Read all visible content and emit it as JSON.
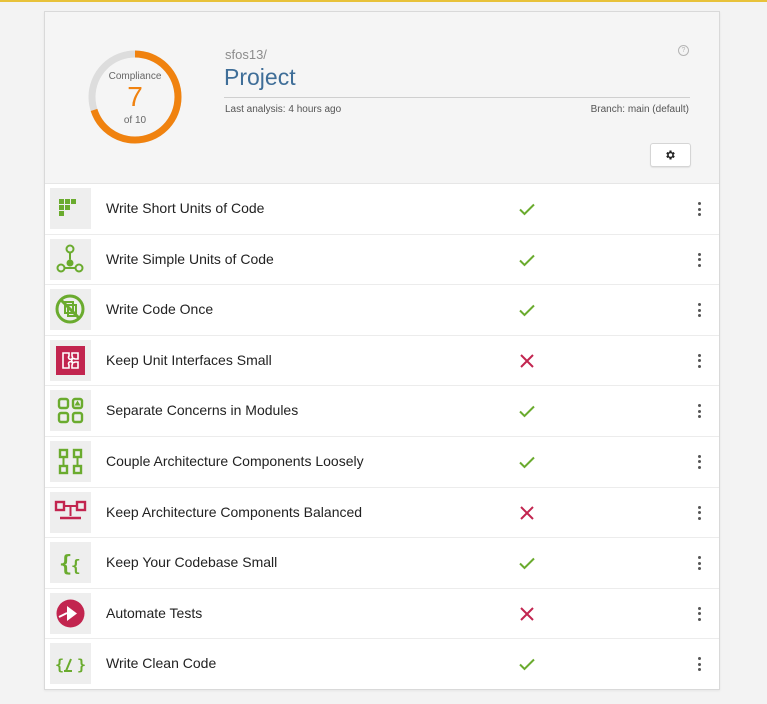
{
  "header": {
    "compliance_label": "Compliance",
    "compliance_value": "7",
    "compliance_of": "of 10",
    "compliance_ratio": 0.7,
    "owner": "sfos13/",
    "project_name": "Project",
    "last_analysis": "Last analysis: 4 hours ago",
    "branch": "Branch: main (default)",
    "help_icon": "?"
  },
  "colors": {
    "gauge_fill": "#f0820f",
    "gauge_track": "#dddddd",
    "pass": "#6aab2e",
    "fail": "#c2254f",
    "title": "#3f6e98"
  },
  "guidelines": [
    {
      "label": "Write Short Units of Code",
      "status": "pass",
      "icon": "short-units-icon"
    },
    {
      "label": "Write Simple Units of Code",
      "status": "pass",
      "icon": "simple-units-icon"
    },
    {
      "label": "Write Code Once",
      "status": "pass",
      "icon": "no-duplication-icon"
    },
    {
      "label": "Keep Unit Interfaces Small",
      "status": "fail",
      "icon": "puzzle-icon"
    },
    {
      "label": "Separate Concerns in Modules",
      "status": "pass",
      "icon": "modules-icon"
    },
    {
      "label": "Couple Architecture Components Loosely",
      "status": "pass",
      "icon": "components-icon"
    },
    {
      "label": "Keep Architecture Components Balanced",
      "status": "fail",
      "icon": "balance-icon"
    },
    {
      "label": "Keep Your Codebase Small",
      "status": "pass",
      "icon": "braces-icon"
    },
    {
      "label": "Automate Tests",
      "status": "fail",
      "icon": "play-icon"
    },
    {
      "label": "Write Clean Code",
      "status": "pass",
      "icon": "clean-code-icon"
    }
  ]
}
